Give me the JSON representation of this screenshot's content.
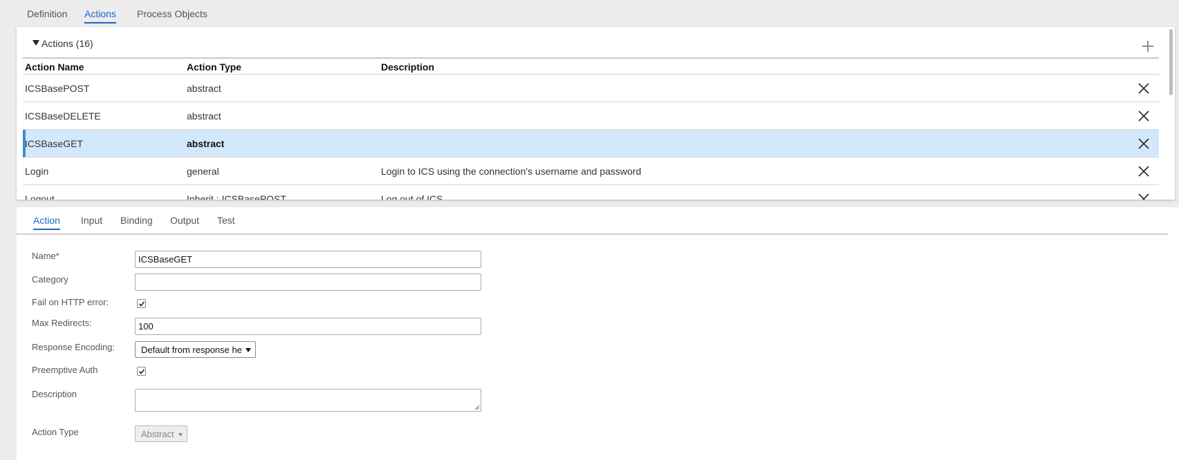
{
  "top_tabs": [
    {
      "label": "Definition",
      "active": false
    },
    {
      "label": "Actions",
      "active": true
    },
    {
      "label": "Process Objects",
      "active": false
    }
  ],
  "actions_panel": {
    "title": "Actions (16)",
    "columns": [
      "Action Name",
      "Action Type",
      "Description"
    ],
    "rows": [
      {
        "name": "ICSBasePOST",
        "type": "abstract",
        "description": ""
      },
      {
        "name": "ICSBaseDELETE",
        "type": "abstract",
        "description": ""
      },
      {
        "name": "ICSBaseGET",
        "type": "abstract",
        "description": "",
        "selected": true
      },
      {
        "name": "Login",
        "type": "general",
        "description": "Login to ICS using the connection's username and password"
      },
      {
        "name": "Logout",
        "type": "Inherit : ICSBasePOST",
        "description": "Log out of ICS"
      }
    ]
  },
  "detail_tabs": [
    {
      "label": "Action",
      "active": true
    },
    {
      "label": "Input",
      "active": false
    },
    {
      "label": "Binding",
      "active": false
    },
    {
      "label": "Output",
      "active": false
    },
    {
      "label": "Test",
      "active": false
    }
  ],
  "form": {
    "name_label": "Name*",
    "name_value": "ICSBaseGET",
    "category_label": "Category",
    "category_value": "",
    "fail_http_label": "Fail on HTTP error:",
    "fail_http_checked": true,
    "max_redirects_label": "Max Redirects:",
    "max_redirects_value": "100",
    "response_encoding_label": "Response Encoding:",
    "response_encoding_value": "Default from response he",
    "preemptive_auth_label": "Preemptive Auth",
    "preemptive_auth_checked": true,
    "description_label": "Description",
    "description_value": "",
    "action_type_label": "Action Type",
    "action_type_value": "Abstract"
  },
  "colors": {
    "accent": "#1a66c9",
    "selected_row": "#d4e8fb",
    "selected_bar": "#3a8fd8"
  },
  "icons": {
    "add": "plus-icon",
    "delete": "close-icon",
    "collapse": "triangle-down-icon"
  }
}
